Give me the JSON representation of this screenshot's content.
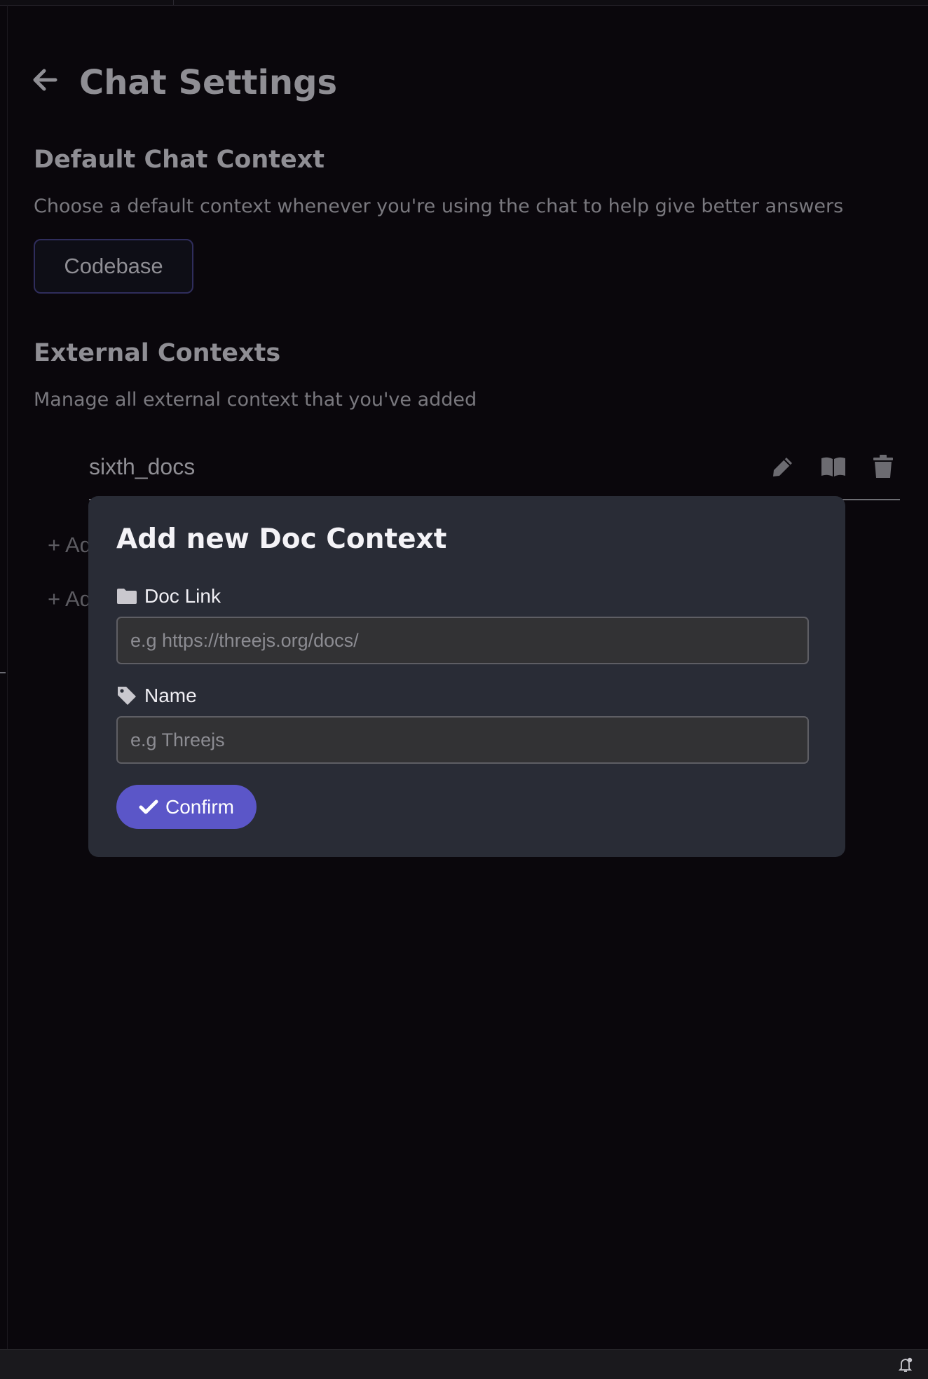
{
  "header": {
    "title": "Chat Settings",
    "back_icon": "arrow-left-icon"
  },
  "default_context": {
    "heading": "Default Chat Context",
    "description": "Choose a default context whenever you're using the chat to help give better answers",
    "selected": "Codebase"
  },
  "external_contexts": {
    "heading": "External Contexts",
    "description": "Manage all external context that you've added",
    "items": [
      {
        "name": "sixth_docs",
        "actions": [
          "pencil-icon",
          "book-icon",
          "trash-icon"
        ]
      }
    ],
    "add_links": [
      "+ Add",
      "+ Add"
    ]
  },
  "modal": {
    "title": "Add new Doc Context",
    "doc_link": {
      "label": "Doc Link",
      "icon": "folder-icon",
      "placeholder": "e.g https://threejs.org/docs/",
      "value": ""
    },
    "name": {
      "label": "Name",
      "icon": "tag-icon",
      "placeholder": "e.g Threejs",
      "value": ""
    },
    "confirm_label": "Confirm",
    "confirm_icon": "check-icon"
  },
  "status_bar": {
    "notification_icon": "bell-icon"
  },
  "colors": {
    "background": "#0a070c",
    "modal": "#292c36",
    "accent": "#5b56c8",
    "muted_text": "#8f8e94"
  }
}
